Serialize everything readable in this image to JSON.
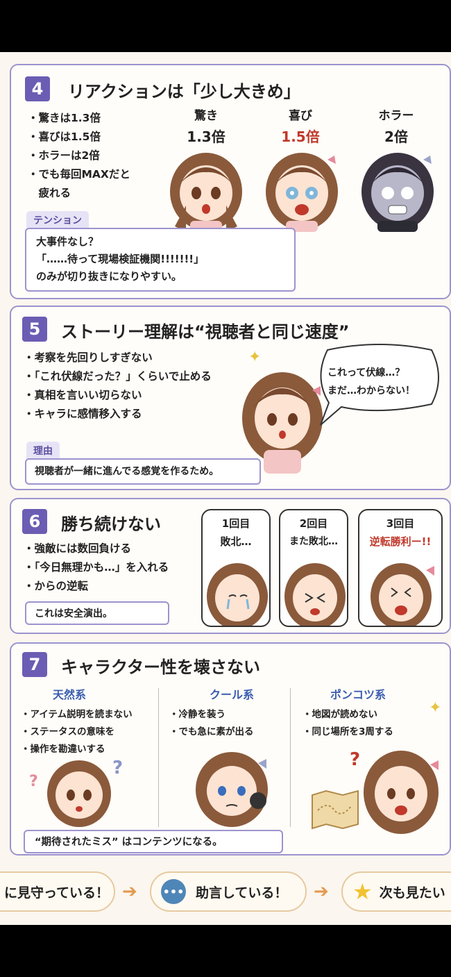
{
  "section4": {
    "number": "4",
    "title": "リアクションは「少し大きめ」",
    "bullets": [
      "・驚きは1.3倍",
      "・喜びは1.5倍",
      "・ホラーは2倍",
      "・でも毎回MAXだと",
      "　疲れる"
    ],
    "reactions": [
      {
        "label": "驚き",
        "value": "1.3倍"
      },
      {
        "label": "喜び",
        "value": "1.5倍"
      },
      {
        "label": "ホラー",
        "value": "2倍"
      }
    ],
    "box_tag": "テンション",
    "box_lines": [
      "大事件なし？",
      "「……待って現場検証機関!!!!!!!」",
      "のみが切り抜きになりやすい。"
    ]
  },
  "section5": {
    "number": "5",
    "title": "ストーリー理解は“視聴者と同じ速度”",
    "bullets": [
      "・考察を先回りしすぎない",
      "・「これ伏線だった？」くらいで止める",
      "・真相を言いい切らない",
      "・キャラに感情移入する"
    ],
    "speech_lines": [
      "これって伏線…？",
      "まだ…わからない！"
    ],
    "box_tag": "理由",
    "box_text": "視聴者が一緒に進んでる感覚を作るため。"
  },
  "section6": {
    "number": "6",
    "title": "勝ち続けない",
    "bullets": [
      "・強敵には数回負ける",
      "・「今日無理かも…」を入れる",
      "・からの逆転"
    ],
    "box_text": "これは安全演出。",
    "panels": [
      {
        "round": "1回目",
        "result": "敗北…"
      },
      {
        "round": "2回目",
        "result": "また敗北…"
      },
      {
        "round": "3回目",
        "result": "逆転勝利ー!!"
      }
    ]
  },
  "section7": {
    "number": "7",
    "title": "キャラクター性を壊さない",
    "columns": [
      {
        "heading": "天然系",
        "bullets": [
          "・アイテム説明を読まない",
          "・ステータスの意味を",
          "・操作を勘違いする"
        ]
      },
      {
        "heading": "クール系",
        "bullets": [
          "・冷静を装う",
          "・でも急に素が出る"
        ]
      },
      {
        "heading": "ポンコツ系",
        "bullets": [
          "・地図が読めない",
          "・同じ場所を3周する"
        ]
      }
    ],
    "footer_box": "“期待されたミス” はコンテンツになる。"
  },
  "flow": {
    "steps": [
      "に見守っている！",
      "助言している！",
      "次も見たい"
    ]
  },
  "colors": {
    "accent": "#6b5db3",
    "border": "#9c93cf",
    "highlight_red": "#c0392b",
    "column_heading": "#3a5db0"
  }
}
